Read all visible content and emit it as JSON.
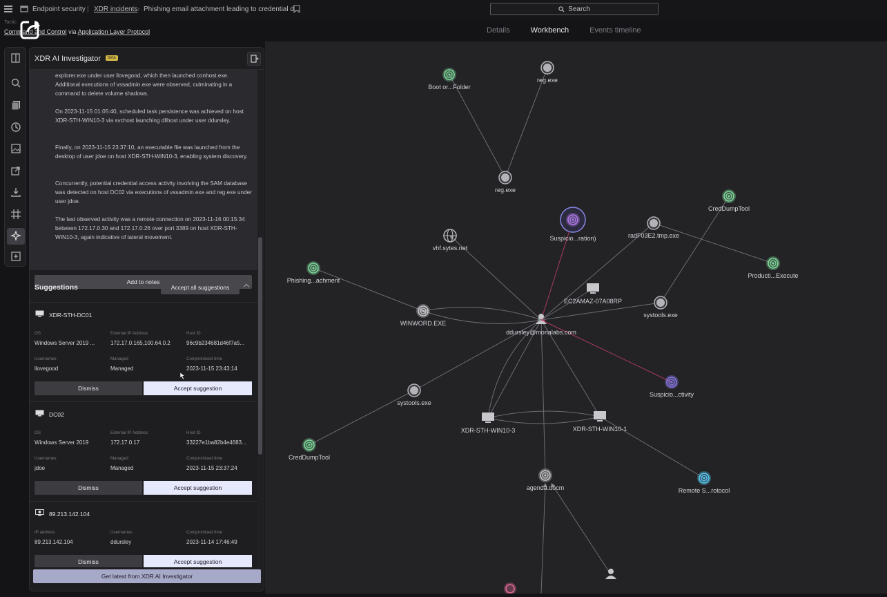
{
  "topbar": {
    "app": "Endpoint security",
    "crumb_incidents": "XDR incidents",
    "crumb_title": "Phishing email attachment leading to credential d...",
    "search_label": "Search"
  },
  "subheader": {
    "tactic_label": "Tactic",
    "prefix": "Command and Control",
    "via": "via",
    "protocol": "Application Layer Protocol"
  },
  "tabs": [
    "Details",
    "Workbench",
    "Events timeline"
  ],
  "investigator": {
    "title": "XDR AI Investigator",
    "badge": "beta",
    "paragraphs": [
      "explorer.exe under user llovegood, which then launched conhost.exe. Additional executions of vssadmin.exe were observed, culminating in a command to delete volume shadows.",
      "On 2023-11-15 01:05:40, scheduled task persistence was achieved on host XDR-STH-WIN10-3 via svchost launching dllhost under user ddursley.",
      "Finally, on 2023-11-15 23:37:10, an executable file was launched from the desktop of user jdoe on host XDR-STH-WIN10-3, enabling system discovery.",
      "Concurrently, potential credential access activity involving the SAM database was detected on host DC02 via executions of vssadmin.exe and reg.exe under user jdoe.",
      "The last observed activity was a remote connection on 2023-11-16 00:15:34 between 172.17.0.30 and 172.17.0.26 over port 3389 on host XDR-STH-WIN10-3, again indicative of lateral movement."
    ],
    "add_to_notes": "Add to notes",
    "suggestions_title": "Suggestions",
    "accept_all": "Accept all suggestions",
    "get_latest": "Get latest from XDR AI Investigator"
  },
  "cards": [
    {
      "title": "XDR-STH-DC01",
      "labels": [
        "OS",
        "External IP Address",
        "Host ID",
        "Usernames",
        "Managed",
        "Compromised time"
      ],
      "values": [
        "Windows Server 2019 ...",
        "172.17.0.165,100.64.0.2",
        "96c9b234681d46f7a5...",
        "llovegood",
        "Managed",
        "2023-11-15 23:43:14"
      ],
      "dismiss": "Dismiss",
      "accept": "Accept suggestion"
    },
    {
      "title": "DC02",
      "labels": [
        "OS",
        "External IP Address",
        "Host ID",
        "Usernames",
        "Managed",
        "Compromised time"
      ],
      "values": [
        "Windows Server 2019",
        "172.17.0.17",
        "33227e1ba82b4e4683...",
        "jdoe",
        "Managed",
        "2023-11-15 23:37:24"
      ],
      "dismiss": "Dismiss",
      "accept": "Accept suggestion"
    },
    {
      "title": "89.213.142.104",
      "labels": [
        "IP address",
        "Usernames",
        "Compromised time"
      ],
      "values": [
        "89.213.142.104",
        "ddursley",
        "2023-11-14 17:46:49"
      ],
      "dismiss": "Dismiss",
      "accept": "Accept suggestion"
    }
  ],
  "graph": {
    "nodes": [
      {
        "label": "Boot or...Folder",
        "icon": "fingerprint-icon",
        "color": "#7fd89a"
      },
      {
        "label": "reg.exe",
        "icon": "process-icon",
        "color": "#b4b4b8"
      },
      {
        "label": "reg.exe",
        "icon": "process-icon",
        "color": "#b4b4b8"
      },
      {
        "label": "CredDumpTool",
        "icon": "fingerprint-icon",
        "color": "#7fd89a"
      },
      {
        "label": "Suspicio...ration)",
        "icon": "fingerprint-icon",
        "color": "#b07ae8"
      },
      {
        "label": "radF03E2.tmp.exe",
        "icon": "process-icon",
        "color": "#b4b4b8"
      },
      {
        "label": "vhf.sytes.net",
        "icon": "globe-icon",
        "color": "#b4b4b8"
      },
      {
        "label": "Producti...Execute",
        "icon": "fingerprint-icon",
        "color": "#7fd89a"
      },
      {
        "label": "Phishing...achment",
        "icon": "fingerprint-icon",
        "color": "#7fd89a"
      },
      {
        "label": "EC2AMAZ-07A08RP",
        "icon": "host-icon",
        "color": "#c8c8cc"
      },
      {
        "label": "systools.exe",
        "icon": "process-icon",
        "color": "#b4b4b8"
      },
      {
        "label": "WINWORD.EXE",
        "icon": "fingerprint-icon",
        "color": "#c8c8cc"
      },
      {
        "label": "ddursley@morialabs.com",
        "icon": "user-icon",
        "color": "#c8c8cc"
      },
      {
        "label": "Suspicio...ctivity",
        "icon": "fingerprint-icon",
        "color": "#8a7ae8"
      },
      {
        "label": "systools.exe",
        "icon": "process-icon",
        "color": "#b4b4b8"
      },
      {
        "label": "XDR-STH-WIN10-3",
        "icon": "host-icon",
        "color": "#c8c8cc"
      },
      {
        "label": "XDR-STH-WIN10-1",
        "icon": "host-icon",
        "color": "#c8c8cc"
      },
      {
        "label": "CredDumpTool",
        "icon": "fingerprint-icon",
        "color": "#7fd89a"
      },
      {
        "label": "agenda.docm",
        "icon": "fingerprint-icon",
        "color": "#c8c8cc"
      },
      {
        "label": "Remote S...rotocol",
        "icon": "fingerprint-icon",
        "color": "#5ac8f0"
      }
    ]
  }
}
